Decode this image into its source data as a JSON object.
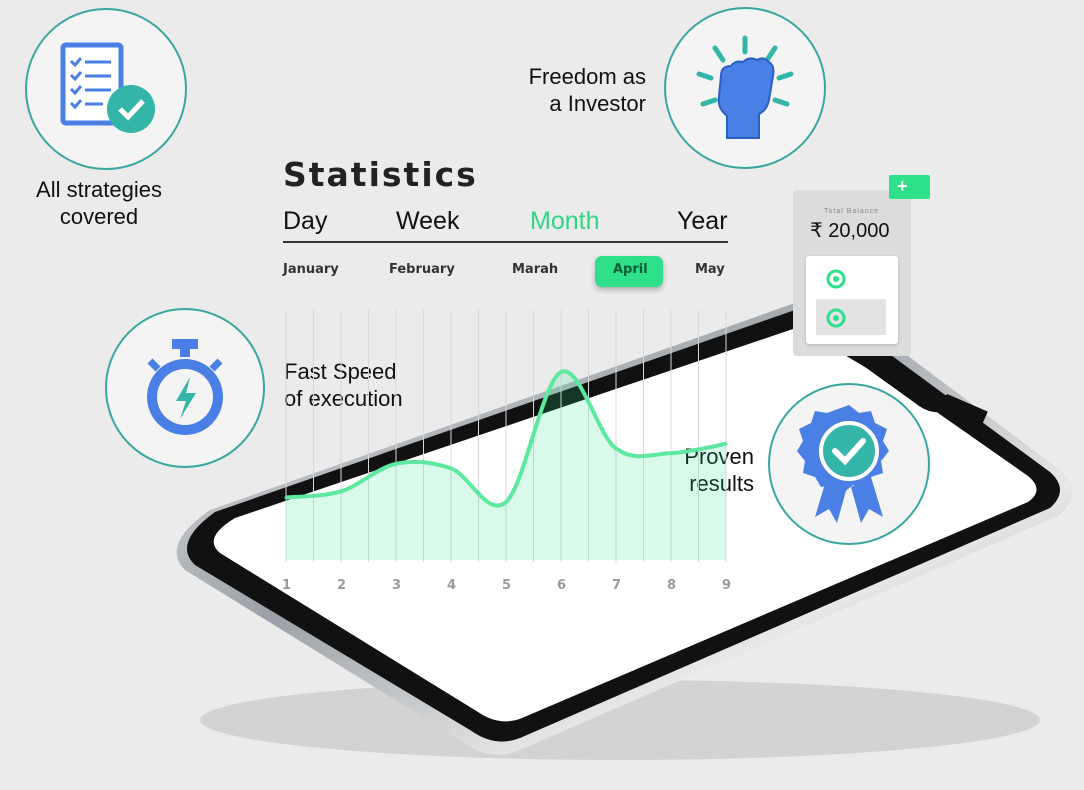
{
  "features": {
    "strategies": "All strategies\ncovered",
    "freedom": "Freedom as\na Investor",
    "speed": "Fast Speed\nof execution",
    "proven": "Proven\nresults"
  },
  "stats": {
    "title": "Statistics",
    "tabs": [
      "Day",
      "Week",
      "Month",
      "Year"
    ],
    "active_tab": "Month",
    "months": [
      "January",
      "February",
      "Marah",
      "April",
      "May"
    ],
    "selected_month": "April",
    "x_labels": [
      "1",
      "2",
      "3",
      "4",
      "5",
      "6",
      "7",
      "8",
      "9"
    ]
  },
  "balance_card": {
    "label": "Total Balance",
    "amount": "₹ 20,000",
    "add_label": "+"
  },
  "colors": {
    "accent": "#2ee08a",
    "teal_ring": "#3aa6a0",
    "icon_blue": "#4a7fe5",
    "check_teal": "#33b6a8"
  },
  "chart_data": {
    "type": "line",
    "x": [
      1,
      2,
      3,
      4,
      5,
      6,
      7,
      8,
      9
    ],
    "categories": [
      "1",
      "2",
      "3",
      "4",
      "5",
      "6",
      "7",
      "8",
      "9"
    ],
    "values": [
      18,
      22,
      40,
      37,
      15,
      100,
      50,
      47,
      53
    ],
    "xlabel": "",
    "ylabel": "",
    "grid": "vertical"
  }
}
